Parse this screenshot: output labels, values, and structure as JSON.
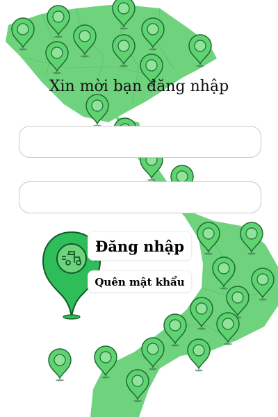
{
  "login_form": {
    "title": "Xin mời bạn đăng nhập",
    "username": {
      "value": "",
      "placeholder": ""
    },
    "password": {
      "value": "",
      "placeholder": ""
    },
    "login_label": "Đăng nhập",
    "forgot_label": "Quên mật khẩu"
  },
  "logo": {
    "icon": "map-pin-motorbike-icon",
    "color": "#2ebd59"
  },
  "background": {
    "map_color": "#6fd37e",
    "pin_color": "#5fd271",
    "icon": "vietnam-map-with-location-pins"
  }
}
